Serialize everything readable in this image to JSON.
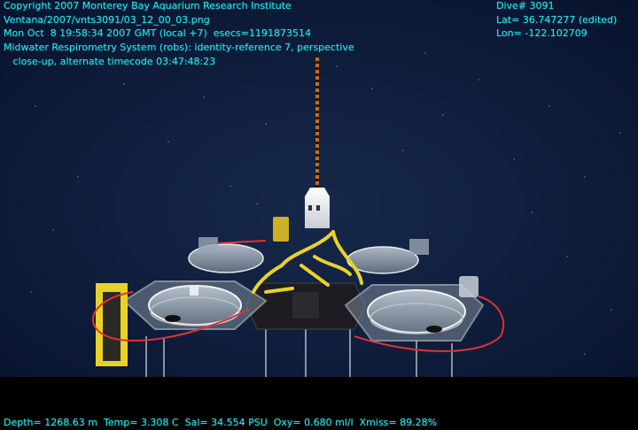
{
  "overlay": {
    "header_lines": [
      "Copyright 2007 Monterey Bay Aquarium Research Institute",
      "Ventana/2007/vnts3091/03_12_00_03.png",
      "Mon Oct  8 19:58:34 2007 GMT (local +7)  esecs=1191873514",
      "Midwater Respirometry System (robs): identity-reference 7, perspective",
      "   close-up, alternate timecode 03:47:48:23"
    ],
    "dive": "Dive# 3091",
    "lat": "Lat= 36.747277 (edited)",
    "lon": "Lon= -122.102709",
    "footer": "Depth= 1268.63 m  Temp= 3.308 C  Sal= 34.554 PSU  Oxy= 0.680 ml/l  Xmiss= 89.28%"
  },
  "colors": {
    "overlay_text": "#22e6ee",
    "water": "#0b1a36",
    "rope": "#c96a1e",
    "yellow_arms": "#e8d22a",
    "red_cable": "#e03232"
  }
}
